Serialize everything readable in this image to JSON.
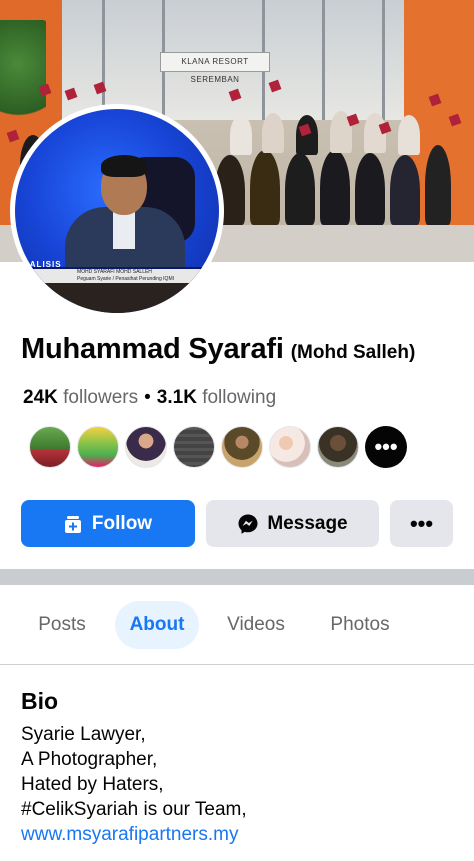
{
  "cover": {
    "sign_text": "KLANA RESORT SEREMBAN"
  },
  "avatar": {
    "tv_brand": "NALISIS",
    "lower_third_name": "MOHD SYARAFI MOHD SALLEH",
    "lower_third_role": "Peguam Syarie / Penasihat Perunding IQMI"
  },
  "profile": {
    "name": "Muhammad Syarafi",
    "alternate_name": "(Mohd Salleh)",
    "followers_count": "24K",
    "followers_label": "followers",
    "separator": "•",
    "following_count": "3.1K",
    "following_label": "following"
  },
  "friends": {
    "more_label": "•••"
  },
  "actions": {
    "follow_label": "Follow",
    "message_label": "Message",
    "more_label": "•••"
  },
  "tabs": [
    {
      "label": "Posts"
    },
    {
      "label": "About"
    },
    {
      "label": "Videos"
    },
    {
      "label": "Photos"
    }
  ],
  "bio": {
    "title": "Bio",
    "lines": [
      "Syarie Lawyer,",
      "A Photographer,",
      "Hated by Haters,",
      "#CelikSyariah is our Team,"
    ],
    "link": "www.msyarafipartners.my"
  },
  "colors": {
    "accent": "#1877f2",
    "secondary_button": "#e4e6eb",
    "muted_text": "#65676b"
  }
}
